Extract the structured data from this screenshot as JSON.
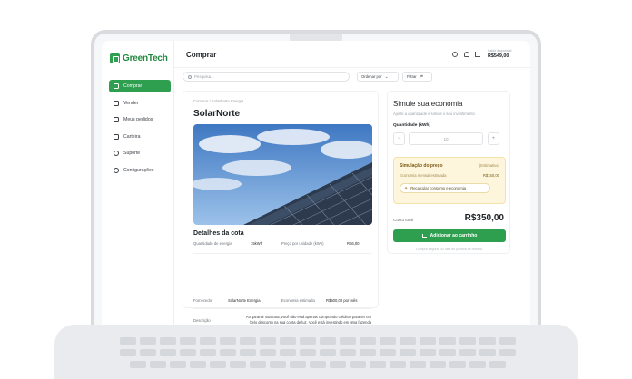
{
  "app": {
    "brand": "GreenTech",
    "brand_color": "#2e9e4f"
  },
  "sidebar": {
    "items": [
      {
        "label": "Comprar",
        "icon": "cart-icon",
        "active": true
      },
      {
        "label": "Vender",
        "icon": "store-icon",
        "active": false
      },
      {
        "label": "Meus pedidos",
        "icon": "orders-icon",
        "active": false
      },
      {
        "label": "Carteira",
        "icon": "wallet-icon",
        "active": false
      },
      {
        "label": "Suporte",
        "icon": "help-icon",
        "active": false
      },
      {
        "label": "Configurações",
        "icon": "gear-icon",
        "active": false
      }
    ]
  },
  "header": {
    "title": "Comprar",
    "balance_label": "Saldo disponível",
    "balance_value": "R$549,00"
  },
  "toolbar": {
    "search_placeholder": "Pesquisa...",
    "sort_label": "Ordenar por",
    "filter_label": "Filtrar"
  },
  "product": {
    "breadcrumb": "Comprar / SolarNorte Energia",
    "name": "SolarNorte",
    "details_title": "Detalhes da cota",
    "energy_label": "Quantidade de energia",
    "energy_value": "15kWh",
    "unit_price_label": "Preço por unidade (kWh)",
    "unit_price_value": "R$6,00",
    "supplier_label": "Fornecedor",
    "supplier_value": "SolarNorte Energia",
    "savings_label": "Economia estimada",
    "savings_value": "R$500,00 por mês",
    "description_label": "Descrição",
    "description_value": "Ao garantir sua cota, você não está apenas comprando créditos para ter um belo desconto na sua conta de luz. Você está investindo em uma fazenda local, que gera empregos na nossa comunidade."
  },
  "simulator": {
    "title": "Simule sua economia",
    "subtitle": "Ajuste a quantidade e simule o seu investimento",
    "quantity_label": "Quantidade (kWh)",
    "quantity_value": "10",
    "minus": "−",
    "plus": "+",
    "sim_title": "Simulação do preço",
    "sim_badge": "(Estimativa)",
    "sim_row_label": "Economia mensal estimada",
    "sim_row_value": "R$150,00",
    "recalc_label": "Recalcular consumo e economia",
    "cost_label": "Custo total",
    "cost_value": "R$350,00",
    "add_label": "Adicionar ao carrinho",
    "note": "Compra segura. 30 dias de política de retorno."
  }
}
